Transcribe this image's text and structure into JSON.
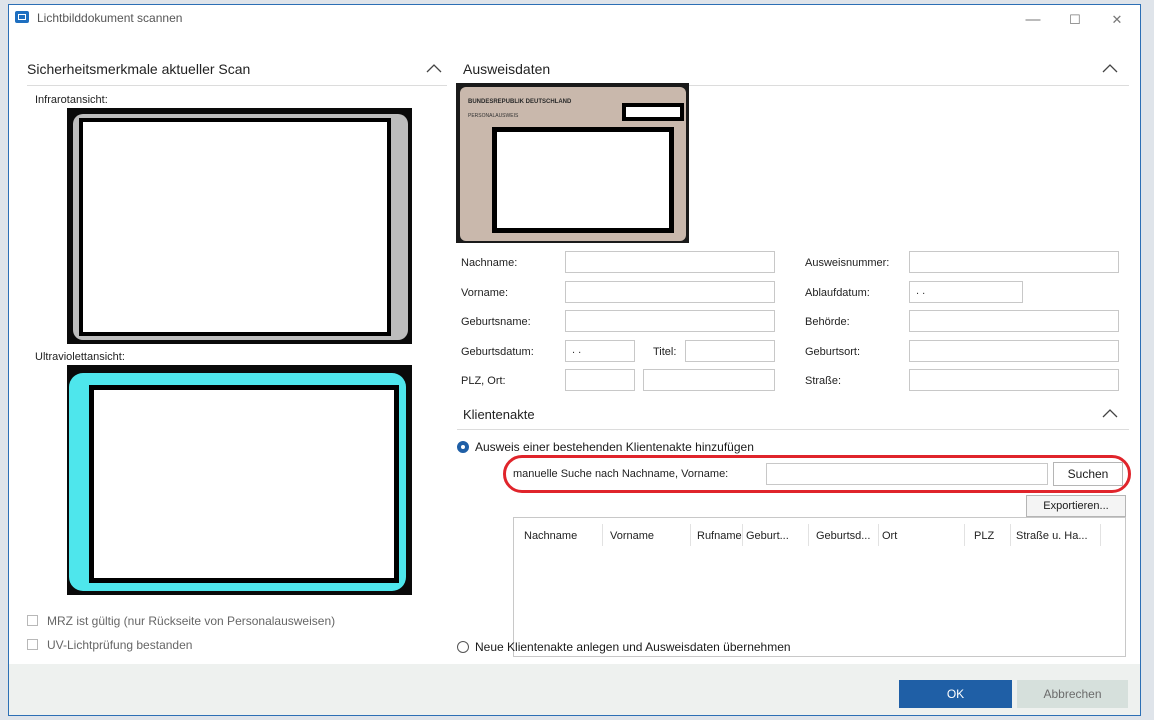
{
  "window": {
    "title": "Lichtbilddokument scannen",
    "minimize": "—",
    "maximize": "☐",
    "close": "✕"
  },
  "left": {
    "section_title": "Sicherheitsmerkmale aktueller Scan",
    "infrared_label": "Infrarotansicht:",
    "uv_label": "Ultraviolettansicht:",
    "mrz_checkbox": "MRZ ist gültig (nur Rückseite von Personalausweisen)",
    "uv_checkbox": "UV-Lichtprüfung bestanden"
  },
  "id_data": {
    "section_title": "Ausweisdaten",
    "card_header": "BUNDESREPUBLIK DEUTSCHLAND",
    "card_sub": "PERSONALAUSWEIS",
    "fields": {
      "nachname": "Nachname:",
      "vorname": "Vorname:",
      "geburtsname": "Geburtsname:",
      "geburtsdatum": "Geburtsdatum:",
      "geburtsdatum_value": ". .",
      "titel": "Titel:",
      "plz_ort": "PLZ, Ort:",
      "ausweisnummer": "Ausweisnummer:",
      "ablaufdatum": "Ablaufdatum:",
      "ablaufdatum_value": ". .",
      "behoerde": "Behörde:",
      "geburtsort": "Geburtsort:",
      "strasse": "Straße:"
    }
  },
  "client": {
    "section_title": "Klientenakte",
    "radio_existing": "Ausweis einer bestehenden Klientenakte hinzufügen",
    "search_label": "manuelle Suche nach Nachname, Vorname:",
    "search_button": "Suchen",
    "export_button": "Exportieren...",
    "columns": [
      "Nachname",
      "Vorname",
      "Rufname",
      "Geburt...",
      "Geburtsd...",
      "Ort",
      "PLZ",
      "Straße u. Ha..."
    ],
    "radio_new": "Neue Klientenakte anlegen und Ausweisdaten übernehmen"
  },
  "footer": {
    "ok": "OK",
    "cancel": "Abbrechen"
  },
  "colors": {
    "accent": "#1f5fa6",
    "highlight": "#e0242b",
    "uv": "#4ee6ec"
  }
}
